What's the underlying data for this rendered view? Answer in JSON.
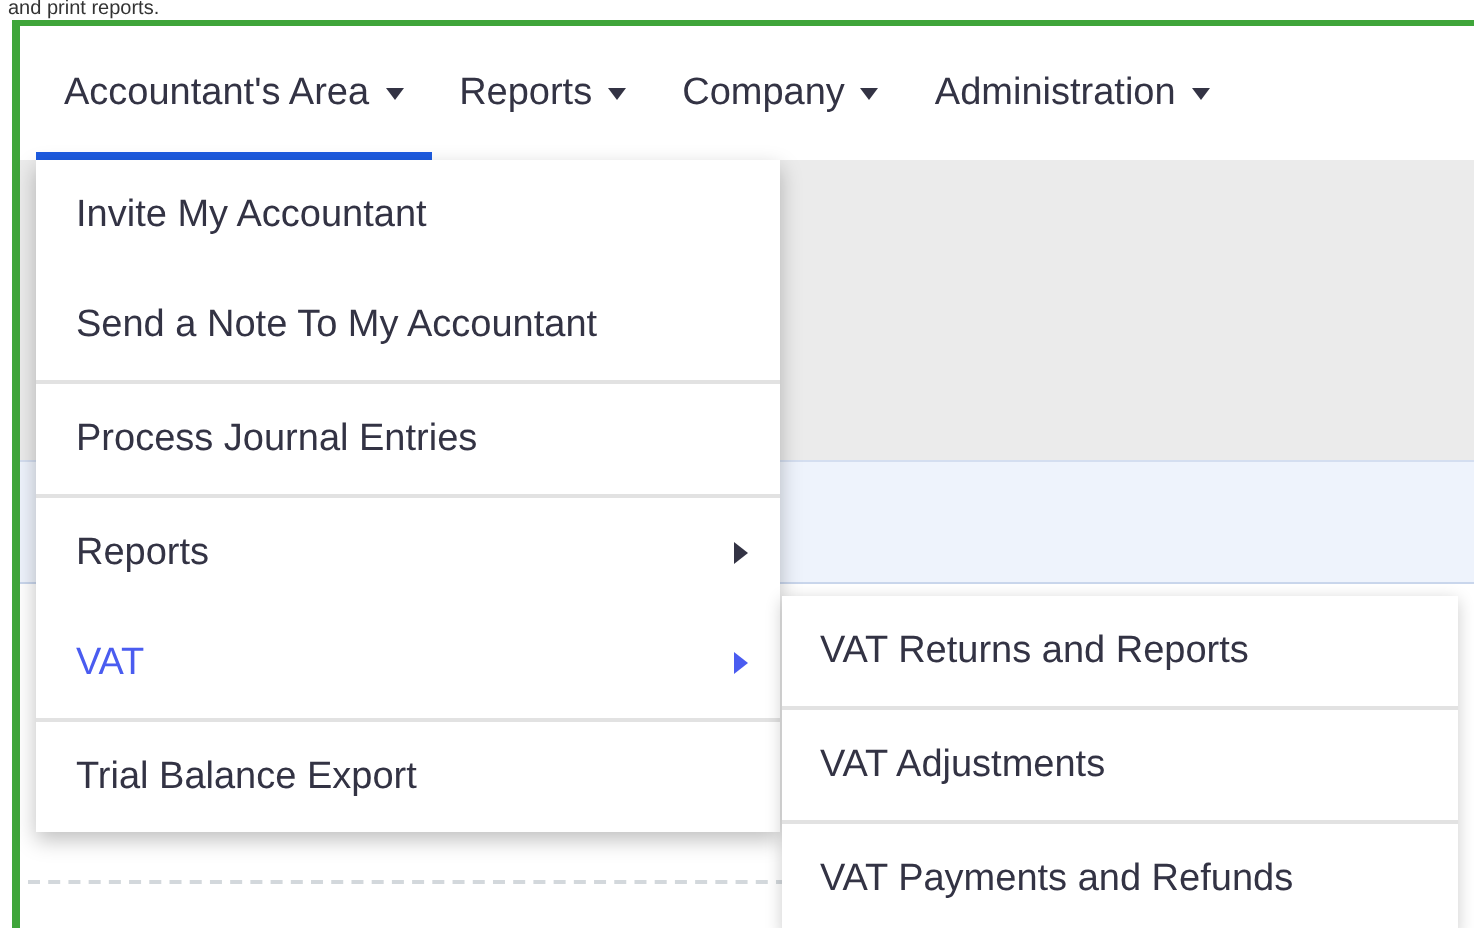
{
  "intro_text": "and print reports.",
  "nav": {
    "tabs": [
      {
        "label": "Accountant's Area",
        "selected": true
      },
      {
        "label": "Reports",
        "selected": false
      },
      {
        "label": "Company",
        "selected": false
      },
      {
        "label": "Administration",
        "selected": false
      }
    ]
  },
  "menu": {
    "groups": [
      [
        {
          "label": "Invite My Accountant",
          "has_submenu": false,
          "selected": false
        },
        {
          "label": "Send a Note To My Accountant",
          "has_submenu": false,
          "selected": false
        }
      ],
      [
        {
          "label": "Process Journal Entries",
          "has_submenu": false,
          "selected": false
        }
      ],
      [
        {
          "label": "Reports",
          "has_submenu": true,
          "selected": false
        },
        {
          "label": "VAT",
          "has_submenu": true,
          "selected": true
        }
      ],
      [
        {
          "label": "Trial Balance Export",
          "has_submenu": false,
          "selected": false
        }
      ]
    ]
  },
  "submenu": {
    "items": [
      {
        "label": "VAT Returns and Reports"
      },
      {
        "label": "VAT Adjustments"
      },
      {
        "label": "VAT Payments and Refunds"
      }
    ]
  }
}
